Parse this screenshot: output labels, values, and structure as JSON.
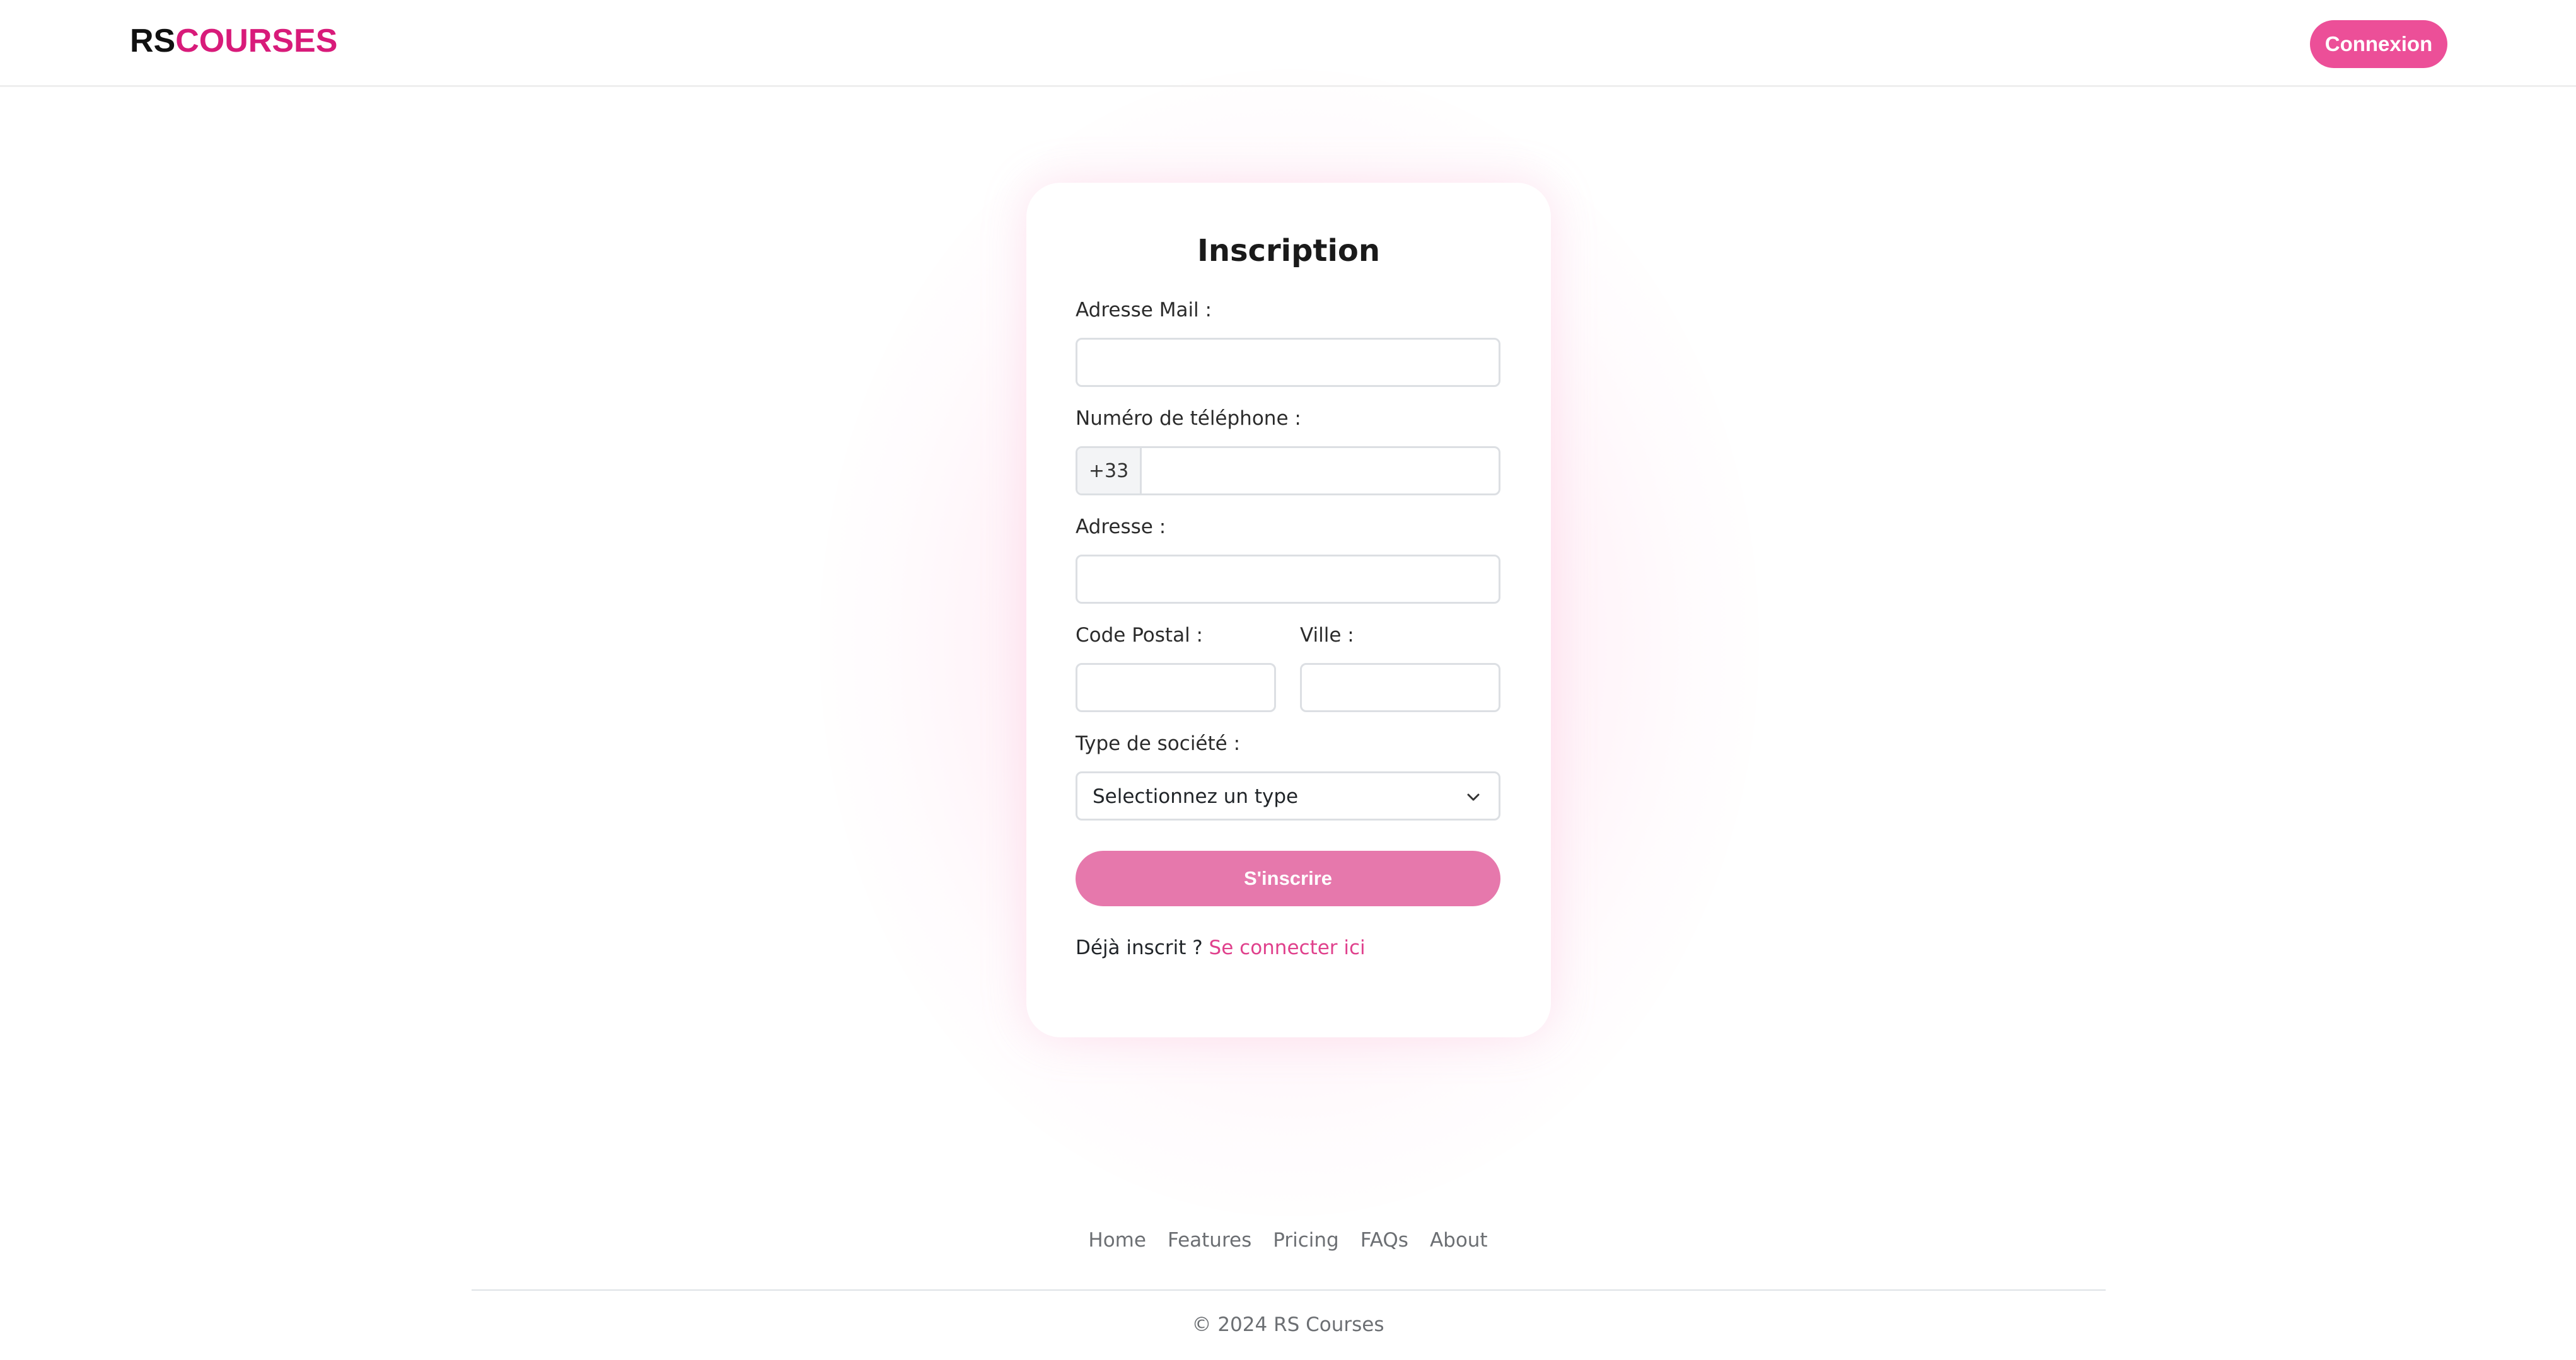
{
  "header": {
    "logo_rs": "RS",
    "logo_courses": "COURSES",
    "login_button": "Connexion"
  },
  "form": {
    "title": "Inscription",
    "email_label": "Adresse Mail :",
    "email_value": "",
    "phone_label": "Numéro de téléphone :",
    "phone_prefix": "+33",
    "phone_value": "",
    "address_label": "Adresse :",
    "address_value": "",
    "postal_label": "Code Postal :",
    "postal_value": "",
    "city_label": "Ville :",
    "city_value": "",
    "company_type_label": "Type de société :",
    "company_type_selected": "Selectionnez un type",
    "submit_label": "S'inscrire",
    "already_text": "Déjà inscrit ?",
    "login_link": "Se connecter ici"
  },
  "footer": {
    "nav": [
      "Home",
      "Features",
      "Pricing",
      "FAQs",
      "About"
    ],
    "copyright": "© 2024 RS Courses"
  },
  "colors": {
    "brand": "#d81b7a",
    "button": "#ec4f98",
    "submit": "#e678ac",
    "link": "#e0408c"
  }
}
